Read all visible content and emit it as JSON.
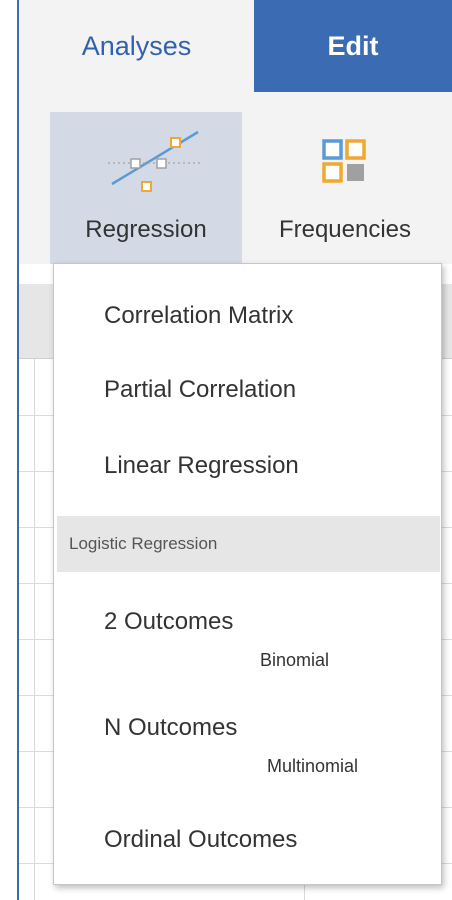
{
  "tabs": [
    {
      "label": "Analyses",
      "active": true
    },
    {
      "label": "Edit",
      "active": false
    }
  ],
  "ribbon": {
    "regression": {
      "label": "Regression",
      "icon": "regression-icon"
    },
    "frequencies": {
      "label": "Frequencies",
      "icon": "frequencies-icon"
    }
  },
  "menu": {
    "items": [
      {
        "label": "Correlation Matrix"
      },
      {
        "label": "Partial Correlation"
      },
      {
        "label": "Linear Regression"
      }
    ],
    "group_header": "Logistic Regression",
    "logistic_items": [
      {
        "label": "2 Outcomes",
        "sub": "Binomial"
      },
      {
        "label": "N Outcomes",
        "sub": "Multinomial"
      },
      {
        "label": "Ordinal Outcomes"
      }
    ]
  },
  "colors": {
    "accent": "#3b6cb3",
    "icon_orange": "#f0a830",
    "icon_blue": "#5b9bd5",
    "icon_gray": "#a0a0a0",
    "selected_btn": "#d3dae6"
  }
}
